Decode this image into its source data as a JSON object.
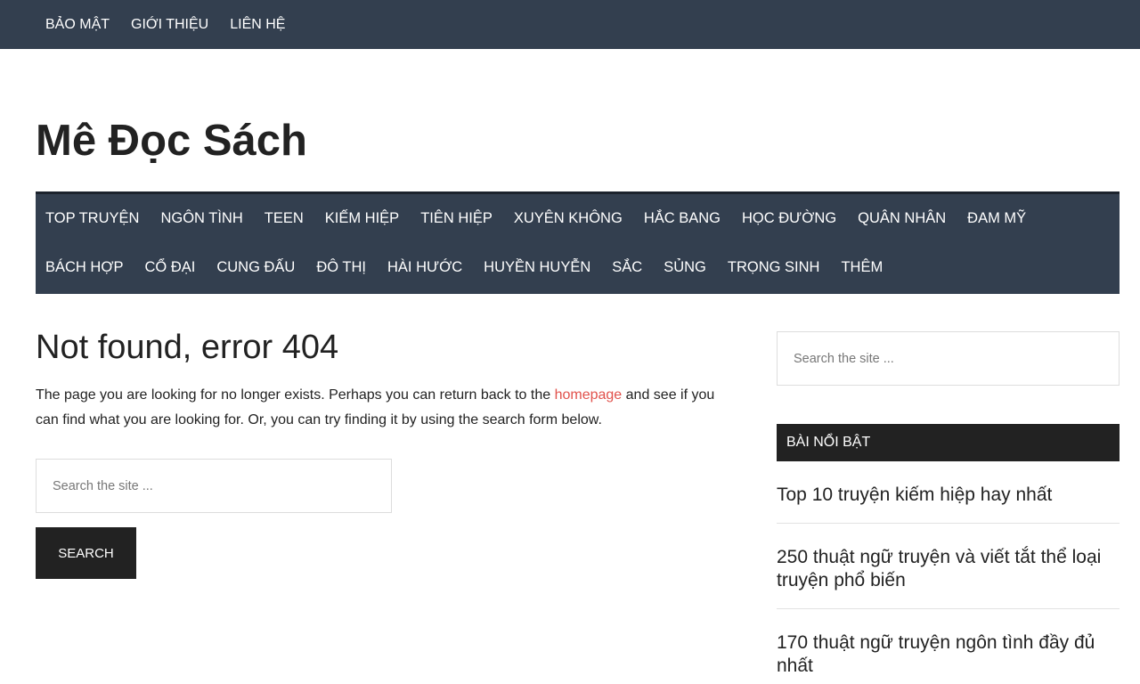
{
  "topbar": {
    "items": [
      "BẢO MẬT",
      "GIỚI THIỆU",
      "LIÊN HỆ"
    ]
  },
  "site": {
    "title": "Mê Đọc Sách"
  },
  "primary_nav": {
    "row1": [
      "TOP TRUYỆN",
      "NGÔN TÌNH",
      "TEEN",
      "KIẾM HIỆP",
      "TIÊN HIỆP",
      "XUYÊN KHÔNG",
      "HẮC BANG",
      "HỌC ĐƯỜNG",
      "QUÂN NHÂN",
      "ĐAM MỸ"
    ],
    "row2": [
      "BÁCH HỢP",
      "CỔ ĐẠI",
      "CUNG ĐẤU",
      "ĐÔ THỊ",
      "HÀI HƯỚC",
      "HUYỀN HUYỄN",
      "SẮC",
      "SỦNG",
      "TRỌNG SINH",
      "THÊM"
    ]
  },
  "main": {
    "heading": "Not found, error 404",
    "body_before_link": "The page you are looking for no longer exists. Perhaps you can return back to the ",
    "link_text": "homepage",
    "body_after_link": " and see if you can find what you are looking for. Or, you can try finding it by using the search form below.",
    "search": {
      "placeholder": "Search the site ...",
      "button_label": "SEARCH"
    }
  },
  "sidebar": {
    "search_placeholder": "Search the site ...",
    "widget_title": "BÀI NỔI BẬT",
    "featured": [
      "Top 10 truyện kiếm hiệp hay nhất",
      "250 thuật ngữ truyện và viết tắt thể loại truyện phổ biến",
      "170 thuật ngữ truyện ngôn tình đầy đủ nhất"
    ]
  },
  "colors": {
    "nav_background": "#333f4f",
    "link_accent": "#e1514b",
    "dark_button": "#222222"
  }
}
